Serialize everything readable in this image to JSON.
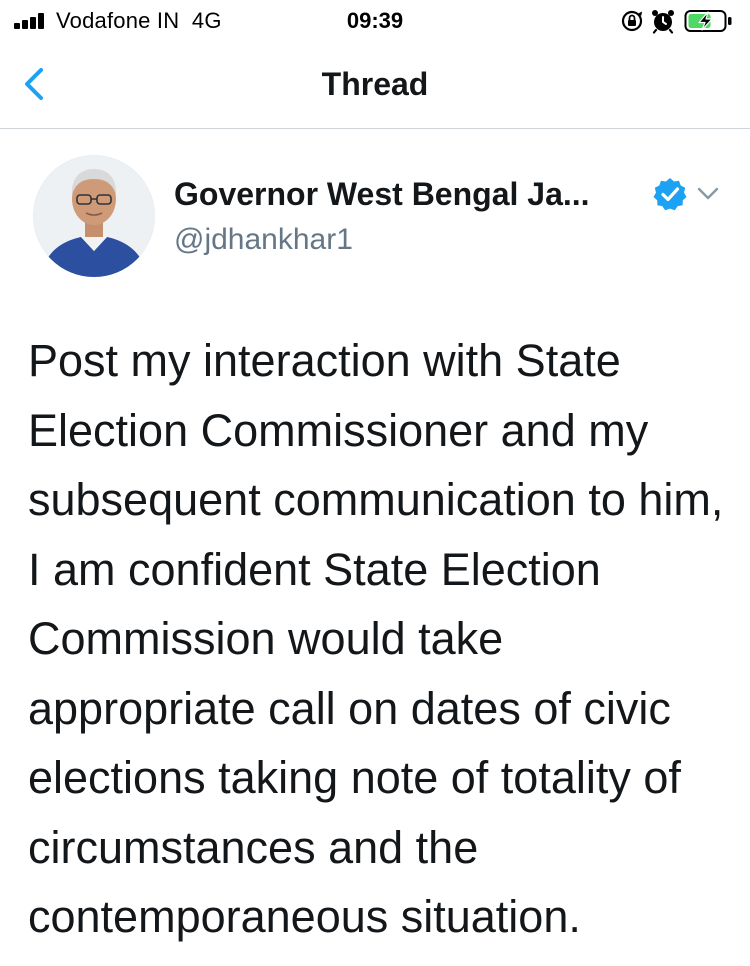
{
  "status_bar": {
    "carrier": "Vodafone IN",
    "network": "4G",
    "time": "09:39",
    "icons": [
      "signal-icon",
      "orientation-lock-icon",
      "alarm-icon",
      "battery-charging-icon"
    ]
  },
  "nav": {
    "back_icon": "chevron-left-icon",
    "title": "Thread"
  },
  "tweet": {
    "author_name": "Governor West Bengal Ja...",
    "handle": "@jdhankhar1",
    "verified": true,
    "text": "Post my interaction with State Election Commissioner and my subsequent communication to him, I am confident State Election Commission would take appropriate call on dates of civic elections taking note of totality of circumstances and the contemporaneous situation."
  },
  "colors": {
    "accent": "#1da1f2",
    "text": "#14171a",
    "secondary_text": "#657786",
    "divider": "#cfd4d9",
    "battery_green": "#4cd964"
  }
}
